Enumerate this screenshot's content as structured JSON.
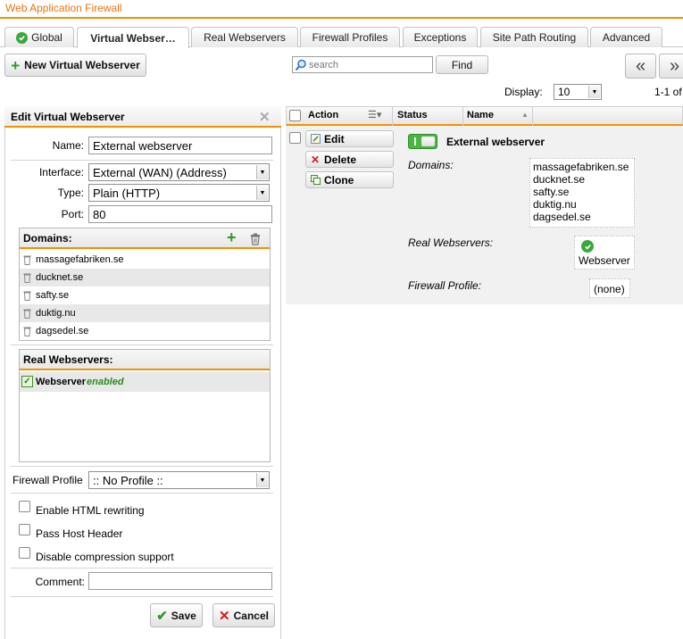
{
  "app": {
    "title": "Web Application Firewall"
  },
  "tabs": [
    {
      "label": "Global",
      "active": false
    },
    {
      "label": "Virtual Webser…",
      "active": true
    },
    {
      "label": "Real Webservers",
      "active": false
    },
    {
      "label": "Firewall Profiles",
      "active": false
    },
    {
      "label": "Exceptions",
      "active": false
    },
    {
      "label": "Site Path Routing",
      "active": false
    },
    {
      "label": "Advanced",
      "active": false
    }
  ],
  "toolbar": {
    "new_button": "New Virtual Webserver",
    "search_placeholder": "search",
    "find_button": "Find",
    "prev_label": "«",
    "next_label": "»",
    "display_label": "Display:",
    "display_value": "10",
    "page_range": "1-1 of"
  },
  "edit": {
    "title": "Edit Virtual Webserver",
    "close_label": "✕",
    "name_label": "Name:",
    "name_value": "External webserver",
    "interface_label": "Interface:",
    "interface_value": "External (WAN) (Address)",
    "type_label": "Type:",
    "type_value": "Plain (HTTP)",
    "port_label": "Port:",
    "port_value": "80",
    "domains_label": "Domains:",
    "domains": [
      "massagefabriken.se",
      "ducknet.se",
      "safty.se",
      "duktig.nu",
      "dagsedel.se"
    ],
    "real_label": "Real Webservers:",
    "real_items": [
      {
        "name": "Webserver",
        "state": "enabled"
      }
    ],
    "profile_label": "Firewall Profile",
    "profile_value": ":: No Profile ::",
    "options": [
      {
        "label": "Enable HTML rewriting",
        "checked": false
      },
      {
        "label": "Pass Host Header",
        "checked": false
      },
      {
        "label": "Disable compression support",
        "checked": false
      }
    ],
    "comment_label": "Comment:",
    "comment_value": "",
    "save_button": "Save",
    "cancel_button": "Cancel"
  },
  "grid": {
    "columns": {
      "action": "Action",
      "status": "Status",
      "name": "Name"
    },
    "actions": {
      "edit": "Edit",
      "delete": "Delete",
      "clone": "Clone"
    },
    "row": {
      "name": "External webserver",
      "enabled": true,
      "domains_label": "Domains:",
      "domains": [
        "massagefabriken.se",
        "ducknet.se",
        "safty.se",
        "duktig.nu",
        "dagsedel.se"
      ],
      "real_label": "Real Webservers:",
      "real_value": "Webserver",
      "profile_label": "Firewall Profile:",
      "profile_value": "(none)"
    }
  },
  "colors": {
    "accent": "#f29100",
    "title": "#e8740f",
    "ok_green": "#3aa83a",
    "enabled_text": "#2a8a1e",
    "cancel_red": "#d21b1b"
  },
  "icons": [
    "ok-circle-icon",
    "plus-icon",
    "search-icon",
    "trash-icon",
    "edit-icon",
    "delete-icon",
    "clone-icon",
    "check-icon",
    "close-icon",
    "dropdown-arrow-icon",
    "chevron-left-icon",
    "chevron-right-icon"
  ]
}
